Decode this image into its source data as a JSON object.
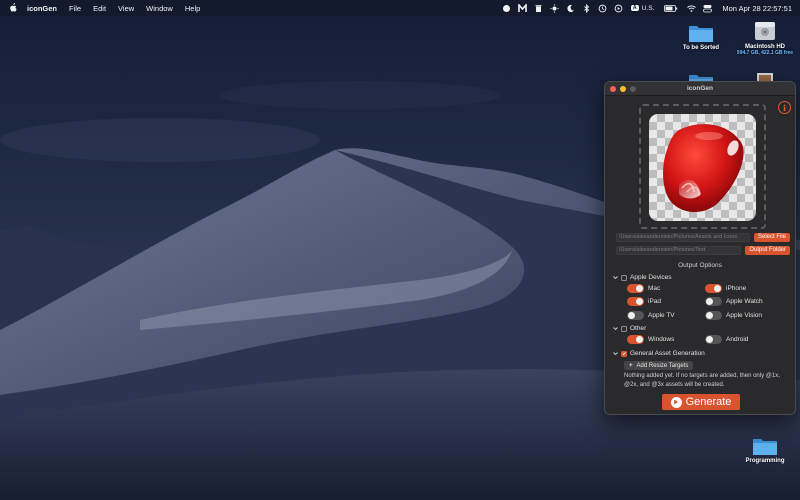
{
  "menubar": {
    "app_name": "iconGen",
    "menus": [
      "File",
      "Edit",
      "View",
      "Window",
      "Help"
    ],
    "input_source_badge": "A",
    "input_source_label": "U.S.",
    "clock": "Mon Apr 28  22:57:51"
  },
  "desktop": {
    "icons": [
      {
        "label": "To be Sorted",
        "sub": ""
      },
      {
        "label": "Macintosh HD",
        "sub": "994.7 GB, 422.1 GB free"
      },
      {
        "label": "Programming",
        "sub": ""
      }
    ]
  },
  "window": {
    "title": "iconGen",
    "info_glyph": "i",
    "source_path": "/Users/alexanderstein/Pictures/Assets and Icons",
    "select_file_label": "Select File",
    "output_path": "/Users/alexanderstein/Pictures/Test",
    "output_folder_label": "Output Folder",
    "output_options_title": "Output Options",
    "sections": {
      "apple": {
        "label": "Apple Devices",
        "checked": false,
        "items": [
          {
            "label": "Mac",
            "on": true
          },
          {
            "label": "iPhone",
            "on": true
          },
          {
            "label": "iPad",
            "on": true
          },
          {
            "label": "Apple Watch",
            "on": false
          },
          {
            "label": "Apple TV",
            "on": false
          },
          {
            "label": "Apple Vision",
            "on": false
          }
        ]
      },
      "other": {
        "label": "Other",
        "checked": false,
        "items": [
          {
            "label": "Windows",
            "on": true
          },
          {
            "label": "Android",
            "on": false
          }
        ]
      },
      "general": {
        "label": "General Asset Generation",
        "checked": true
      }
    },
    "add_targets_label": "Add Resize Targets",
    "hint": "Nothing added yet. If no targets are added, then only @1x, @2x, and @3x assets will be created.",
    "generate_label": "Generate",
    "colors": {
      "accent": "#d9542e",
      "window_bg": "#2a2a2c"
    }
  }
}
